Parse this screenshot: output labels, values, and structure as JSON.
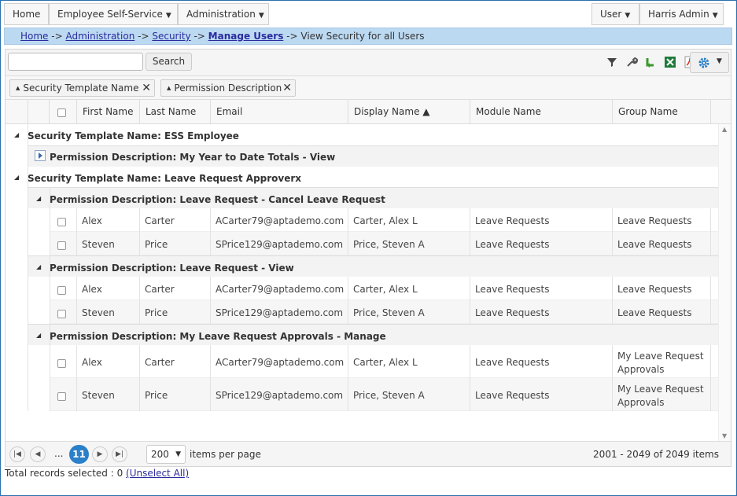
{
  "menu": {
    "home": "Home",
    "ess": "Employee Self-Service",
    "admin": "Administration",
    "user": "User",
    "account": "Harris Admin"
  },
  "breadcrumb": {
    "home": "Home",
    "admin": "Administration",
    "security": "Security",
    "manage_users": "Manage Users",
    "current": "View Security for all Users",
    "sep": "->"
  },
  "toolbar": {
    "search_value": "",
    "search_label": "Search"
  },
  "groups": {
    "chip1": "Security Template Name",
    "chip2": "Permission Description"
  },
  "columns": {
    "first": "First Name",
    "last": "Last Name",
    "email": "Email",
    "display": "Display Name ▲",
    "module": "Module Name",
    "group": "Group Name"
  },
  "rows": {
    "g1": "Security Template Name: ESS Employee",
    "g1p1": "Permission Description: My Year to Date Totals - View",
    "g2": "Security Template Name: Leave Request Approverx",
    "g2p1": "Permission Description: Leave Request - Cancel Leave Request",
    "g2p2": "Permission Description: Leave Request - View",
    "g2p3": "Permission Description: My Leave Request Approvals - Manage",
    "r1": {
      "first": "Alex",
      "last": "Carter",
      "email": "ACarter79@aptademo.com",
      "display": "Carter, Alex L",
      "module": "Leave Requests",
      "group": "Leave Requests"
    },
    "r2": {
      "first": "Steven",
      "last": "Price",
      "email": "SPrice129@aptademo.com",
      "display": "Price, Steven A",
      "module": "Leave Requests",
      "group": "Leave Requests"
    },
    "r3": {
      "first": "Alex",
      "last": "Carter",
      "email": "ACarter79@aptademo.com",
      "display": "Carter, Alex L",
      "module": "Leave Requests",
      "group": "Leave Requests"
    },
    "r4": {
      "first": "Steven",
      "last": "Price",
      "email": "SPrice129@aptademo.com",
      "display": "Price, Steven A",
      "module": "Leave Requests",
      "group": "Leave Requests"
    },
    "r5": {
      "first": "Alex",
      "last": "Carter",
      "email": "ACarter79@aptademo.com",
      "display": "Carter, Alex L",
      "module": "Leave Requests",
      "group_l1": "My Leave Request",
      "group_l2": "Approvals"
    },
    "r6": {
      "first": "Steven",
      "last": "Price",
      "email": "SPrice129@aptademo.com",
      "display": "Price, Steven A",
      "module": "Leave Requests",
      "group_l1": "My Leave Request",
      "group_l2": "Approvals"
    }
  },
  "pager": {
    "ellipsis": "...",
    "current_page": "11",
    "page_size": "200",
    "items_per_page": "items per page",
    "range": "2001 - 2049 of 2049 items"
  },
  "footer": {
    "total_label": "Total records selected : 0",
    "unselect": "(Unselect All)"
  },
  "colors": {
    "accent": "#2a80c9",
    "crumb_bg": "#bcd9f2",
    "frame": "#2a6fb0"
  }
}
